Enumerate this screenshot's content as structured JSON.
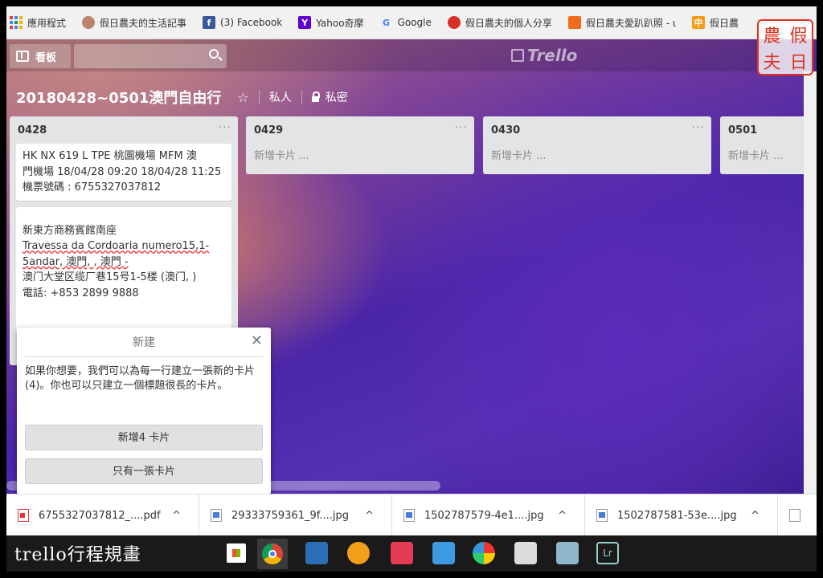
{
  "bookmarks": [
    {
      "label": "應用程式",
      "icon": "apps-icon",
      "color": "#e0443e"
    },
    {
      "label": "假日農夫的生活記事",
      "icon": "avatar-icon",
      "color": "#b9856b"
    },
    {
      "label": "(3) Facebook",
      "icon": "facebook-icon",
      "color": "#3b5998",
      "glyph": "f"
    },
    {
      "label": "Yahoo奇摩",
      "icon": "yahoo-icon",
      "color": "#5f01d1",
      "glyph": "Y"
    },
    {
      "label": "Google",
      "icon": "google-icon",
      "color": "#ffffff",
      "glyph": "G"
    },
    {
      "label": "假日農夫的個人分享",
      "icon": "location-icon",
      "color": "#d93025"
    },
    {
      "label": "假日農夫愛趴趴照 - ι",
      "icon": "blog-icon",
      "color": "#f26b1d"
    },
    {
      "label": "假日農",
      "icon": "chinese-site-icon",
      "color": "#f39c12",
      "glyph": "中"
    }
  ],
  "header": {
    "boards_label": "看板",
    "logo_text": "Trello"
  },
  "board": {
    "title": "20180428~0501澳門自由行",
    "visibility_label": "私人",
    "privacy_label": "私密"
  },
  "lists": [
    {
      "name": "0428",
      "cards": [
        {
          "lines": [
            "HK NX 619 L TPE 桃園機場 MFM 澳",
            "門機場 18/04/28 09:20 18/04/28 11:25",
            "機票號碼 : 6755327037812"
          ]
        },
        {
          "lines": [
            "",
            "新東方商務賓館南座",
            "Travessa da Cordoaria numero15,1-",
            "5andar, 澳門, , 澳門 -",
            "澳门大堂区缆厂巷15号1-5楼 (澳门, )",
            "電話: +853 2899 9888",
            ""
          ]
        }
      ]
    },
    {
      "name": "0429",
      "add_card": "新增卡片 ..."
    },
    {
      "name": "0430",
      "add_card": "新增卡片 ..."
    },
    {
      "name": "0501",
      "add_card": "新增卡片 ..."
    }
  ],
  "popover": {
    "title": "新建",
    "body": "如果你想要，我們可以為每一行建立一張新的卡片 (4)。你也可以只建立一個標題很長的卡片。",
    "primary_btn": "新增4 卡片",
    "secondary_btn": "只有一張卡片"
  },
  "downloads": [
    {
      "name": "6755327037812_....pdf",
      "type": "pdf"
    },
    {
      "name": "29333759361_9f....jpg",
      "type": "img"
    },
    {
      "name": "1502787579-4e1....jpg",
      "type": "img"
    },
    {
      "name": "1502787581-53e....jpg",
      "type": "img"
    }
  ],
  "taskbar": {
    "caption": "trello行程規畫"
  },
  "stamp": {
    "chars": [
      "農",
      "假",
      "夫",
      "日"
    ]
  },
  "colors": {
    "stamp_red": "#d32",
    "card_bg": "#ffffff",
    "list_bg": "#e2e4e6"
  }
}
